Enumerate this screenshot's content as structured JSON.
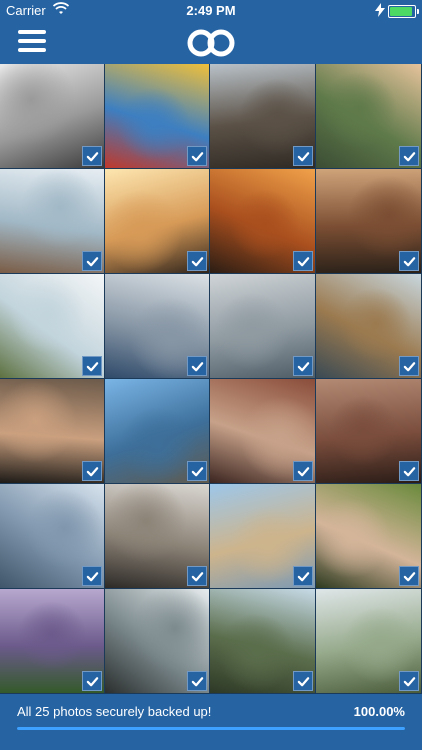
{
  "status_bar": {
    "carrier": "Carrier",
    "time": "2:49 PM",
    "icons": [
      "wifi-icon",
      "charging-icon",
      "battery-icon"
    ]
  },
  "nav": {
    "menu_icon": "hamburger-menu-icon",
    "logo_icon": "infinity-logo-icon"
  },
  "photos": [
    {
      "name": "photo-man-at-window",
      "colors": [
        "#e9e9e9",
        "#9a9a9a",
        "#3a3a3a"
      ]
    },
    {
      "name": "photo-woman-graffiti",
      "colors": [
        "#f0c03a",
        "#3d7fc1",
        "#c0392b"
      ]
    },
    {
      "name": "photo-campfire-group",
      "colors": [
        "#b9c2c9",
        "#5b5146",
        "#2f2a24"
      ]
    },
    {
      "name": "photo-bicycle-storefront",
      "colors": [
        "#e6c39c",
        "#5f7a4a",
        "#3b4d34"
      ]
    },
    {
      "name": "photo-woman-beach-dog",
      "colors": [
        "#e7eef3",
        "#a1b8c6",
        "#7a5c45"
      ]
    },
    {
      "name": "photo-pier-sunset-group",
      "colors": [
        "#fde6b0",
        "#d79a57",
        "#2f241c"
      ]
    },
    {
      "name": "photo-couple-sunset-field",
      "colors": [
        "#f1a24a",
        "#a94f1e",
        "#2b1d14"
      ]
    },
    {
      "name": "photo-man-beach-writing",
      "colors": [
        "#cfa47a",
        "#7b4e33",
        "#2a2119"
      ]
    },
    {
      "name": "photo-couple-dog-sea",
      "colors": [
        "#f4f6f7",
        "#c2d4dc",
        "#5d7140"
      ]
    },
    {
      "name": "photo-baby-sleeping",
      "colors": [
        "#dce2e6",
        "#8796a5",
        "#2f4a6a"
      ]
    },
    {
      "name": "photo-father-daughter",
      "colors": [
        "#cfd4d7",
        "#8f9aa1",
        "#4e5c66"
      ]
    },
    {
      "name": "photo-couple-dock",
      "colors": [
        "#c8d7de",
        "#9b7a4f",
        "#3a4a54"
      ]
    },
    {
      "name": "photo-friends-selfie",
      "colors": [
        "#6c5a4a",
        "#caa07f",
        "#1d1a17"
      ]
    },
    {
      "name": "photo-hikers-summit",
      "colors": [
        "#7ab5e6",
        "#3d6f9a",
        "#5f5a4e"
      ]
    },
    {
      "name": "photo-couple-embrace",
      "colors": [
        "#8a4d3a",
        "#c7a189",
        "#3b2520"
      ]
    },
    {
      "name": "photo-dog-blanket",
      "colors": [
        "#b38a74",
        "#7a4d3c",
        "#2a1c17"
      ]
    },
    {
      "name": "photo-harbor-town",
      "colors": [
        "#d7e3ee",
        "#7f96ad",
        "#40566a"
      ]
    },
    {
      "name": "photo-woman-laptop",
      "colors": [
        "#dad7d2",
        "#8c8377",
        "#2d2a27"
      ]
    },
    {
      "name": "photo-family-beach",
      "colors": [
        "#9dc7ea",
        "#cdb48c",
        "#7d9ab3"
      ]
    },
    {
      "name": "photo-grandparents-child",
      "colors": [
        "#6a8a3c",
        "#d4b59a",
        "#2d3a1f"
      ]
    },
    {
      "name": "photo-waterfall-purple",
      "colors": [
        "#b7a8cf",
        "#6b5a8b",
        "#345a2a"
      ]
    },
    {
      "name": "photo-waterfall-rocks",
      "colors": [
        "#e7ecee",
        "#7c8a8e",
        "#2b2f2e"
      ]
    },
    {
      "name": "photo-waterfall-cliff",
      "colors": [
        "#c7dbe8",
        "#5b6e4c",
        "#2e3926"
      ]
    },
    {
      "name": "photo-meadow-flowers",
      "colors": [
        "#dfe6e8",
        "#95a98a",
        "#4a5c3a"
      ]
    }
  ],
  "backup": {
    "status_text": "All 25 photos securely backed up!",
    "percent_text": "100.00%",
    "progress": 1.0
  }
}
